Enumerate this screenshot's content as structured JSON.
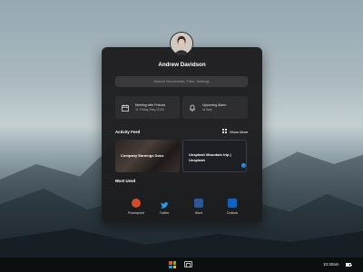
{
  "user": {
    "name": "Andrew Davidson"
  },
  "search": {
    "placeholder": "Search Documents, Files, Settings"
  },
  "cards": [
    {
      "title": "Meeting with Friends",
      "subtitle": "11 Friday May 2018",
      "icon": "calendar-icon"
    },
    {
      "title": "Upcoming Alarm",
      "subtitle": "at 8am",
      "icon": "bell-icon"
    }
  ],
  "activity_feed": {
    "title": "Activity Feed",
    "show_more": "Show More",
    "items": [
      {
        "title": "Company Earnings Docs"
      },
      {
        "title": "Unsplash Mountain trip |",
        "title2": "Unsplash"
      }
    ]
  },
  "most_used": {
    "title": "Most Used",
    "apps": [
      {
        "label": "Powerpoint",
        "color": "#d64b27"
      },
      {
        "label": "Twitter",
        "color": "#1da1f2"
      },
      {
        "label": "Word",
        "color": "#2b579a"
      },
      {
        "label": "Outlook",
        "color": "#0a64c9"
      }
    ]
  },
  "taskbar": {
    "time": "10:30am"
  },
  "colors": {
    "windows_logo": [
      "#f25022",
      "#7fba00",
      "#00a4ef",
      "#ffb900"
    ]
  }
}
